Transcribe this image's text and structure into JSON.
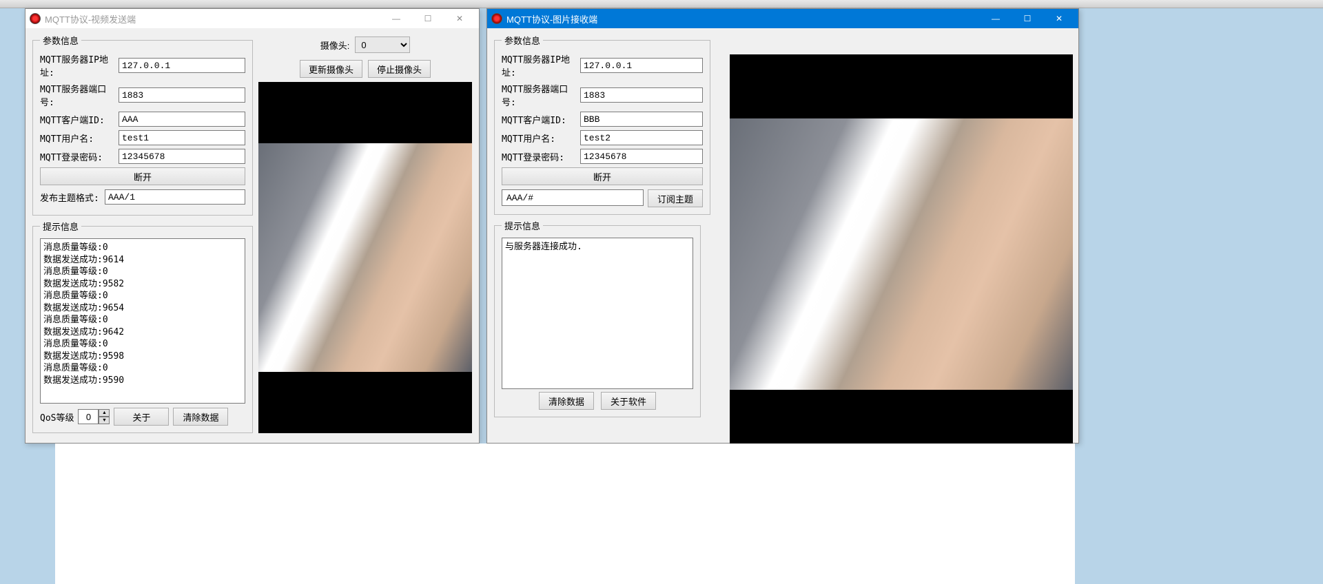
{
  "sender": {
    "title": "MQTT协议-视频发送端",
    "group_params": "参数信息",
    "labels": {
      "server_ip": "MQTT服务器IP地址:",
      "server_port": "MQTT服务器端口号:",
      "client_id": "MQTT客户端ID:",
      "username": "MQTT用户名:",
      "password": "MQTT登录密码:",
      "pub_topic": "发布主题格式:",
      "camera": "摄像头:",
      "qos": "QoS等级"
    },
    "values": {
      "server_ip": "127.0.0.1",
      "server_port": "1883",
      "client_id": "AAA",
      "username": "test1",
      "password": "12345678",
      "pub_topic": "AAA/1",
      "camera": "0",
      "qos": "0"
    },
    "buttons": {
      "disconnect": "断开",
      "update_cam": "更新摄像头",
      "stop_cam": "停止摄像头",
      "about": "关于",
      "clear": "清除数据"
    },
    "group_hint": "提示信息",
    "log": "消息质量等级:0\n数据发送成功:9614\n消息质量等级:0\n数据发送成功:9582\n消息质量等级:0\n数据发送成功:9654\n消息质量等级:0\n数据发送成功:9642\n消息质量等级:0\n数据发送成功:9598\n消息质量等级:0\n数据发送成功:9590"
  },
  "receiver": {
    "title": "MQTT协议-图片接收端",
    "group_params": "参数信息",
    "labels": {
      "server_ip": "MQTT服务器IP地址:",
      "server_port": "MQTT服务器端口号:",
      "client_id": "MQTT客户端ID:",
      "username": "MQTT用户名:",
      "password": "MQTT登录密码:"
    },
    "values": {
      "server_ip": "127.0.0.1",
      "server_port": "1883",
      "client_id": "BBB",
      "username": "test2",
      "password": "12345678",
      "sub_topic": "AAA/#"
    },
    "buttons": {
      "disconnect": "断开",
      "subscribe": "订阅主题",
      "clear": "清除数据",
      "about": "关于软件"
    },
    "group_hint": "提示信息",
    "log": "与服务器连接成功."
  },
  "win_controls": {
    "min": "—",
    "max": "☐",
    "close": "✕"
  }
}
